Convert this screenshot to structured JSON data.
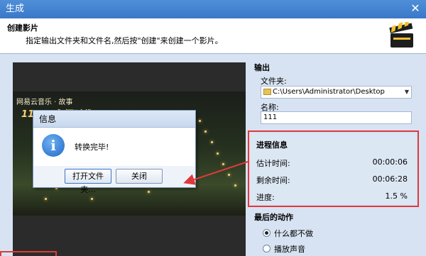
{
  "window": {
    "title": "生成",
    "close_glyph": "✕"
  },
  "header": {
    "title": "创建影片",
    "description": "指定输出文件夹和文件名,然后按\"创建\"来创建一个影片。"
  },
  "video": {
    "caption": "网易云音乐 · 故事",
    "date_text": "11/19 永恒时代"
  },
  "message_box": {
    "title": "信息",
    "icon_glyph": "i",
    "text": "转换完毕!",
    "open_folder_label": "打开文件夹...",
    "close_label": "关闭"
  },
  "output": {
    "section_label": "输出",
    "folder_label": "文件夹:",
    "folder_value": "C:\\Users\\Administrator\\Desktop",
    "name_label": "名称:",
    "name_value": "111"
  },
  "progress": {
    "section_label": "进程信息",
    "estimated_label": "估计时间:",
    "estimated_value": "00:00:06",
    "remaining_label": "剩余时间:",
    "remaining_value": "00:06:28",
    "progress_label": "进度:",
    "progress_value": "1.5 %"
  },
  "final_action": {
    "section_label": "最后的动作",
    "options": [
      "什么都不做",
      "播放声音"
    ],
    "selected_index": 0
  },
  "colors": {
    "annotation_red": "#e0393a",
    "titlebar_blue": "#3a78c8"
  }
}
